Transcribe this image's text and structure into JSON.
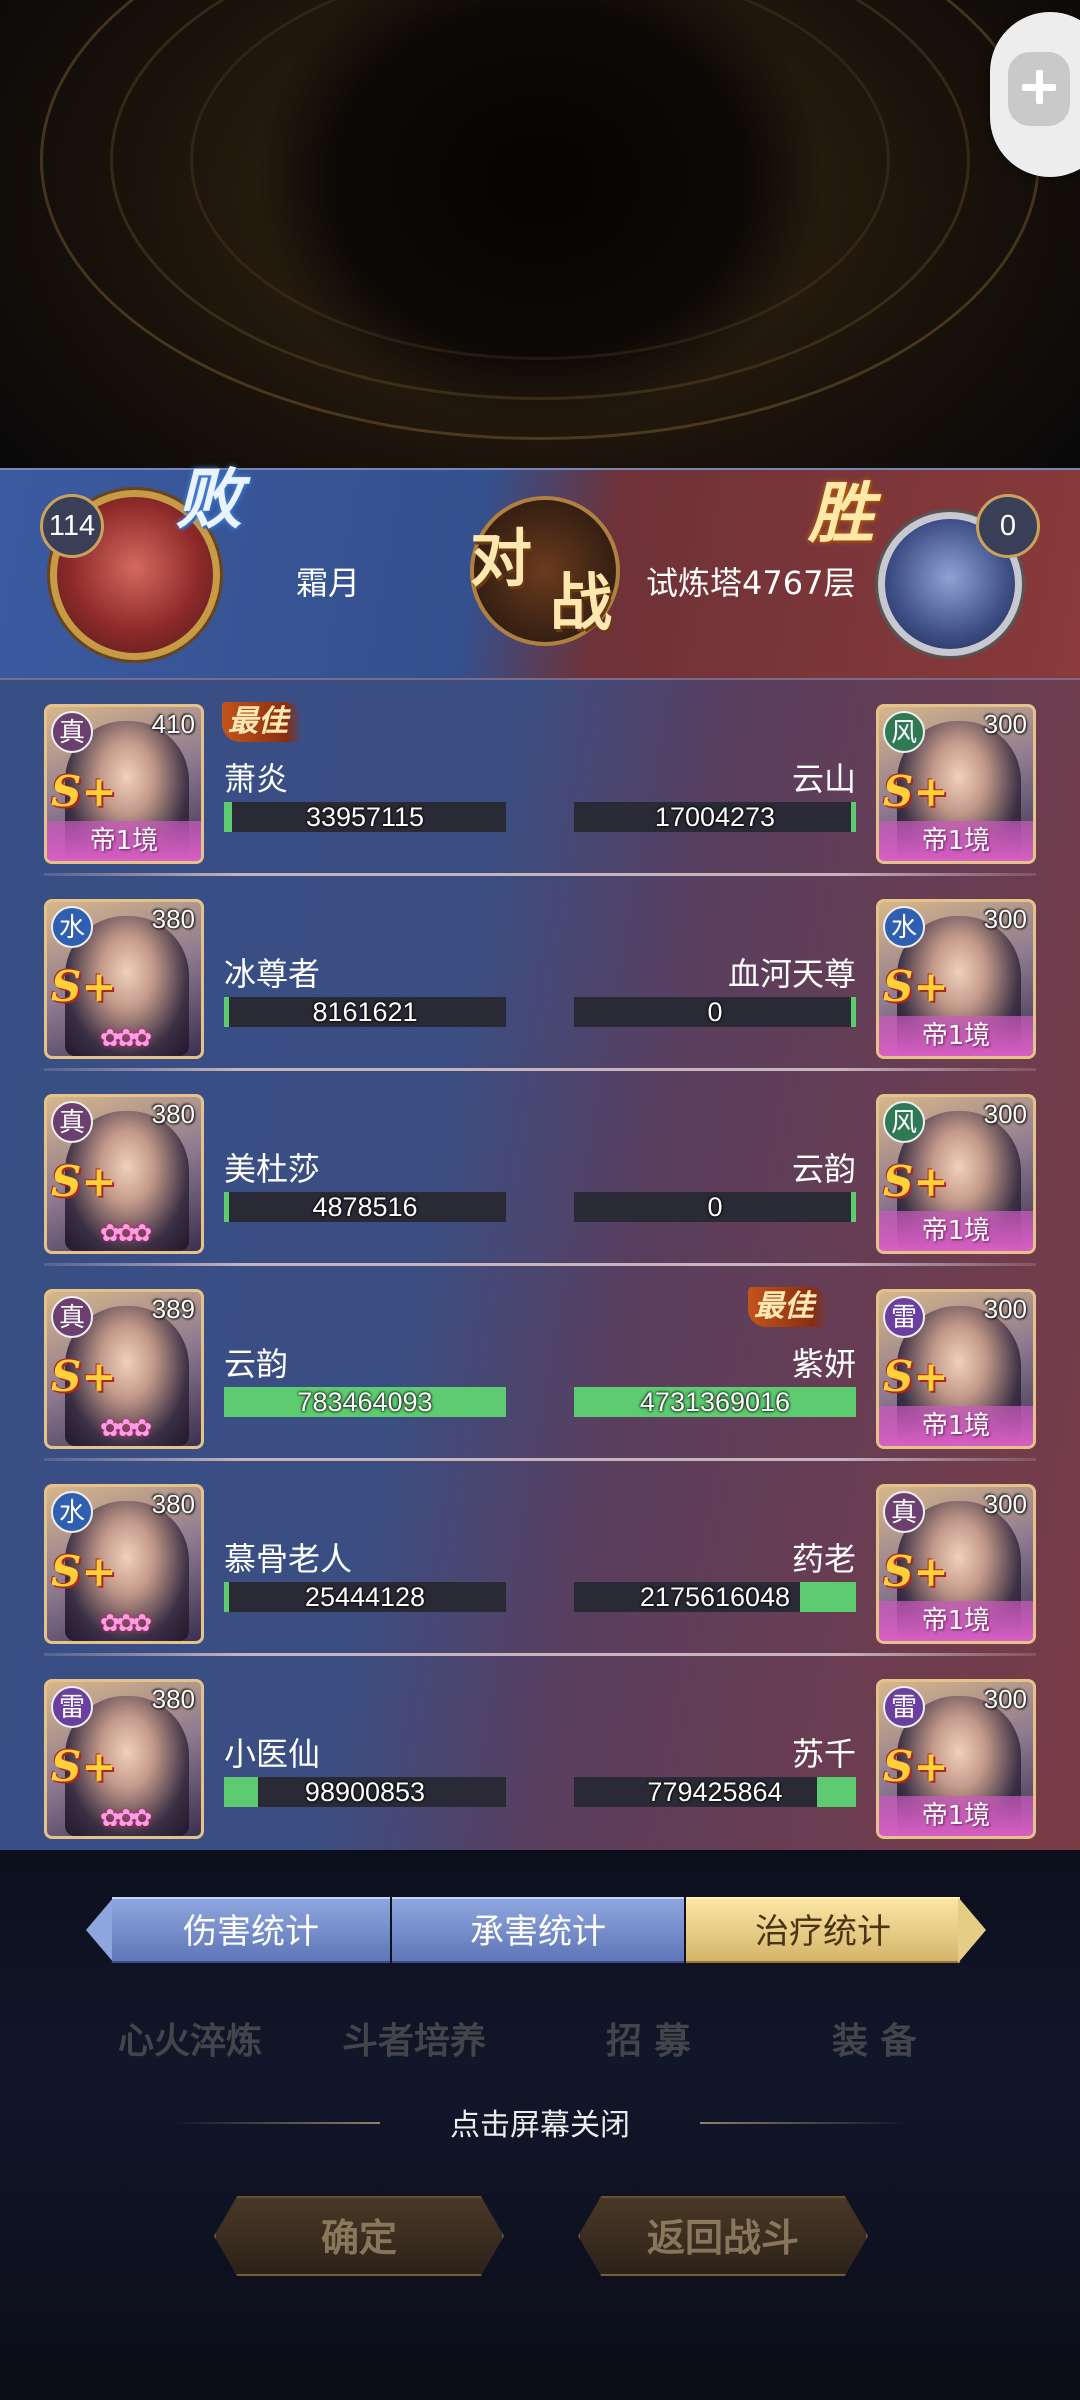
{
  "header": {
    "left": {
      "level": "114",
      "result": "败",
      "name": "霜月"
    },
    "right": {
      "level": "0",
      "result": "胜",
      "name": "试炼塔4767层"
    },
    "vs_left": "对",
    "vs_right": "战"
  },
  "best_label": "最佳",
  "rows": [
    {
      "left": {
        "element": "真",
        "element_color": "#6b3f6e",
        "number": "410",
        "grade": "S+",
        "rank": "帝1境",
        "name": "萧炎",
        "value": "33957115",
        "fill": 0.03,
        "best": true
      },
      "right": {
        "element": "风",
        "element_color": "#2f7a55",
        "number": "300",
        "grade": "S+",
        "rank": "帝1境",
        "name": "云山",
        "value": "17004273",
        "fill": 0.0,
        "best": false
      }
    },
    {
      "left": {
        "element": "水",
        "element_color": "#2e5fb0",
        "number": "380",
        "grade": "S+",
        "rank": "",
        "name": "冰尊者",
        "value": "8161621",
        "fill": 0.0,
        "best": false
      },
      "right": {
        "element": "水",
        "element_color": "#2e5fb0",
        "number": "300",
        "grade": "S+",
        "rank": "帝1境",
        "name": "血河天尊",
        "value": "0",
        "fill": 0.0,
        "best": false
      }
    },
    {
      "left": {
        "element": "真",
        "element_color": "#6b3f6e",
        "number": "380",
        "grade": "S+",
        "rank": "",
        "name": "美杜莎",
        "value": "4878516",
        "fill": 0.0,
        "best": false
      },
      "right": {
        "element": "风",
        "element_color": "#2f7a55",
        "number": "300",
        "grade": "S+",
        "rank": "帝1境",
        "name": "云韵",
        "value": "0",
        "fill": 0.0,
        "best": false
      }
    },
    {
      "left": {
        "element": "真",
        "element_color": "#6b3f6e",
        "number": "389",
        "grade": "S+",
        "rank": "",
        "name": "云韵",
        "value": "783464093",
        "fill": 1.0,
        "best": false
      },
      "right": {
        "element": "雷",
        "element_color": "#6b3fa0",
        "number": "300",
        "grade": "S+",
        "rank": "帝1境",
        "name": "紫妍",
        "value": "4731369016",
        "fill": 1.0,
        "best": true
      }
    },
    {
      "left": {
        "element": "水",
        "element_color": "#2e5fb0",
        "number": "380",
        "grade": "S+",
        "rank": "",
        "name": "慕骨老人",
        "value": "25444128",
        "fill": 0.01,
        "best": false
      },
      "right": {
        "element": "真",
        "element_color": "#6b3f6e",
        "number": "300",
        "grade": "S+",
        "rank": "帝1境",
        "name": "药老",
        "value": "2175616048",
        "fill": 0.2,
        "best": false
      }
    },
    {
      "left": {
        "element": "雷",
        "element_color": "#6b3fa0",
        "number": "380",
        "grade": "S+",
        "rank": "",
        "name": "小医仙",
        "value": "98900853",
        "fill": 0.12,
        "best": false
      },
      "right": {
        "element": "雷",
        "element_color": "#6b3fa0",
        "number": "300",
        "grade": "S+",
        "rank": "帝1境",
        "name": "苏千",
        "value": "779425864",
        "fill": 0.14,
        "best": false
      }
    }
  ],
  "tabs": [
    {
      "label": "伤害统计",
      "active": false
    },
    {
      "label": "承害统计",
      "active": false
    },
    {
      "label": "治疗统计",
      "active": true
    }
  ],
  "background_labels": [
    "心火淬炼",
    "斗者培养",
    "招 募",
    "装 备"
  ],
  "close_hint": "点击屏幕关闭",
  "buttons": {
    "confirm": "确定",
    "return_battle": "返回战斗"
  }
}
